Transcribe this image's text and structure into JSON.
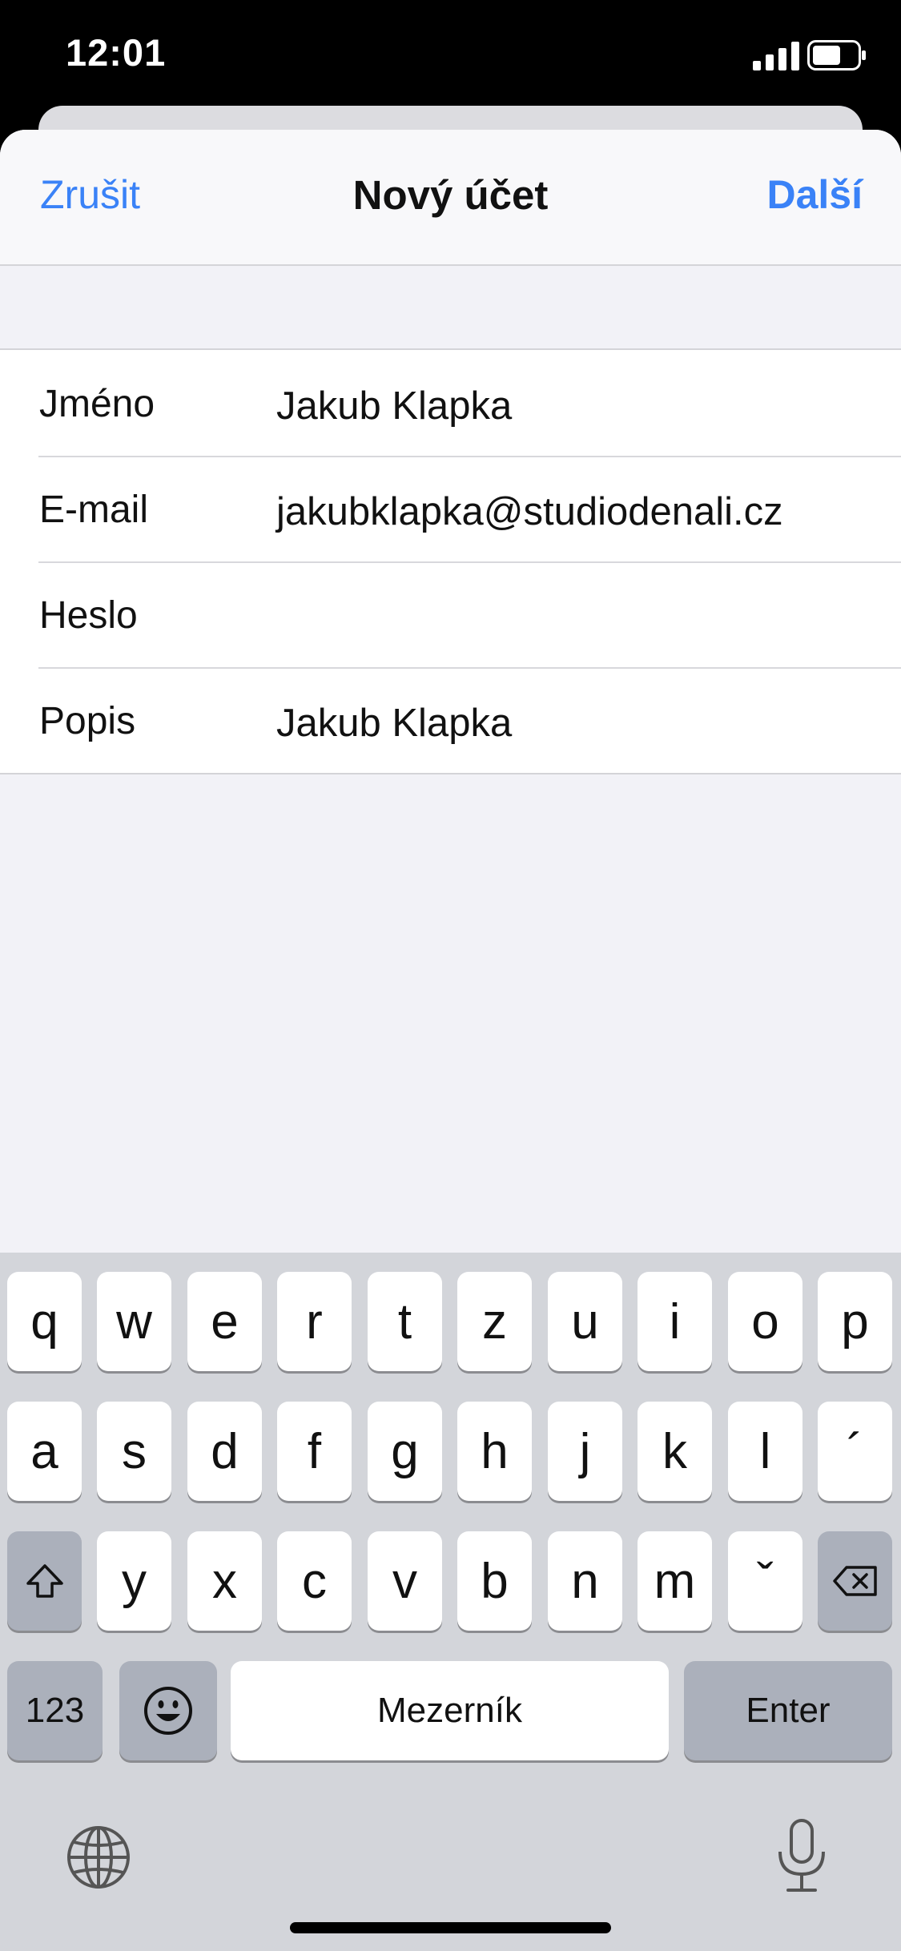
{
  "status_bar": {
    "time": "12:01",
    "signal_icon": "cellular-signal-icon",
    "battery_icon": "battery-icon"
  },
  "nav": {
    "cancel_label": "Zrušit",
    "title": "Nový účet",
    "next_label": "Další"
  },
  "form": {
    "rows": [
      {
        "label": "Jméno",
        "value": "Jakub Klapka"
      },
      {
        "label": "E-mail",
        "value": "jakubklapka@studiodenali.cz"
      },
      {
        "label": "Heslo",
        "value": ""
      },
      {
        "label": "Popis",
        "value": "Jakub Klapka"
      }
    ]
  },
  "keyboard": {
    "row1": [
      "q",
      "w",
      "e",
      "r",
      "t",
      "z",
      "u",
      "i",
      "o",
      "p"
    ],
    "row2": [
      "a",
      "s",
      "d",
      "f",
      "g",
      "h",
      "j",
      "k",
      "l",
      "´"
    ],
    "row3": [
      "y",
      "x",
      "c",
      "v",
      "b",
      "n",
      "m",
      "ˇ"
    ],
    "numbers_label": "123",
    "space_label": "Mezerník",
    "enter_label": "Enter",
    "shift_icon": "shift-icon",
    "delete_icon": "delete-icon",
    "emoji_icon": "emoji-icon",
    "globe_icon": "globe-icon",
    "mic_icon": "microphone-icon"
  },
  "colors": {
    "accent": "#3a82f7",
    "keyboard_bg": "#d3d5da",
    "key_dark": "#abb0bb"
  }
}
